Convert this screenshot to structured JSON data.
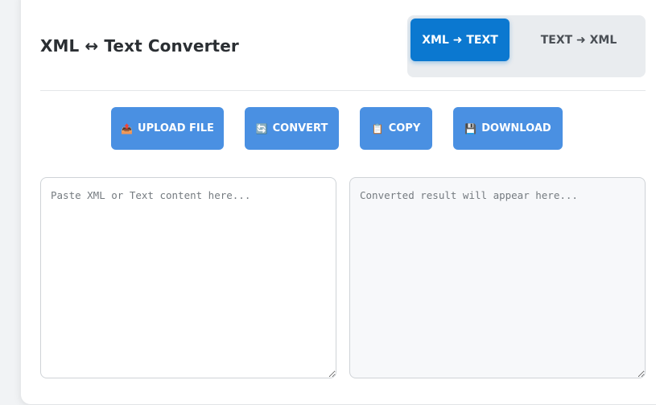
{
  "header": {
    "title": "XML ↔ Text Converter"
  },
  "mode_toggle": {
    "active_label": "XML ➜ TEXT",
    "inactive_label": "TEXT ➜ XML"
  },
  "toolbar": {
    "upload": {
      "icon": "upload-icon",
      "glyph": "📤",
      "label": "UPLOAD FILE"
    },
    "convert": {
      "icon": "refresh-icon",
      "glyph": "🔄",
      "label": "CONVERT"
    },
    "copy": {
      "icon": "clipboard-icon",
      "glyph": "📋",
      "label": "COPY"
    },
    "download": {
      "icon": "floppy-disk-icon",
      "glyph": "💾",
      "label": "DOWNLOAD"
    }
  },
  "editors": {
    "input_placeholder": "Paste XML or Text content here...",
    "input_value": "",
    "output_placeholder": "Converted result will appear here...",
    "output_value": ""
  },
  "colors": {
    "accent": "#0b78d0",
    "button": "#4a90e2",
    "toggle_bg": "#e9ecef"
  }
}
